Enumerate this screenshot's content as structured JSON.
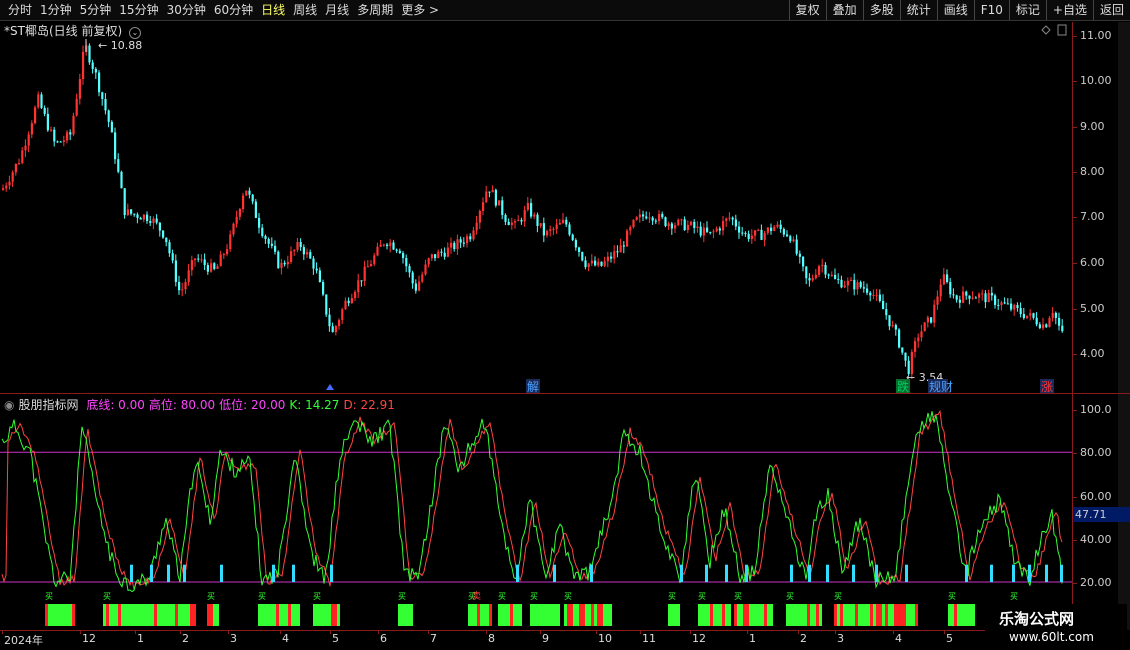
{
  "toolbar": {
    "periods": [
      "分时",
      "1分钟",
      "5分钟",
      "15分钟",
      "30分钟",
      "60分钟",
      "日线",
      "周线",
      "月线",
      "多周期",
      "更多 >"
    ],
    "active_index": 6,
    "buttons": [
      "复权",
      "叠加",
      "多股",
      "统计",
      "画线",
      "F10",
      "标记",
      "+自选",
      "返回"
    ]
  },
  "main": {
    "title": "*ST椰岛(日线 前复权)",
    "high_label": "10.88",
    "low_label": "3.54",
    "price_ticks": [
      "11.00",
      "10.00",
      "9.00",
      "8.00",
      "7.00",
      "6.00",
      "5.00",
      "4.00"
    ],
    "events": [
      {
        "text": "解",
        "color": "#4aa3ff"
      },
      {
        "text": "跌",
        "color": "#00cc66"
      },
      {
        "text": "规财",
        "color": "#4aa3ff"
      },
      {
        "text": "涨",
        "color": "#ff3333"
      }
    ]
  },
  "indicator": {
    "name": "股朋指标网",
    "params": [
      {
        "label": "底线: 0.00",
        "color": "#ff44ff"
      },
      {
        "label": "高位: 80.00",
        "color": "#ff44ff"
      },
      {
        "label": "低位: 20.00",
        "color": "#ff44ff"
      },
      {
        "label": "K: 14.27",
        "color": "#33ff33"
      },
      {
        "label": "D: 22.91",
        "color": "#ff4444"
      }
    ],
    "ticks": [
      "100.0",
      "80.00",
      "60.00",
      "40.00",
      "20.00"
    ],
    "current": "47.71",
    "buy_mark": "买",
    "sell_mark": "卖"
  },
  "dates": [
    "2024年",
    "12",
    "1",
    "2",
    "3",
    "4",
    "5",
    "6",
    "7",
    "8",
    "9",
    "10",
    "11",
    "12",
    "1",
    "2",
    "3",
    "4",
    "5"
  ],
  "watermark": {
    "title": "乐淘公式网",
    "url": "www.60lt.com"
  },
  "colors": {
    "up": "#ff3333",
    "down": "#54ffff",
    "k": "#33ff33",
    "d": "#ff4444",
    "level": "#cc33cc"
  }
}
